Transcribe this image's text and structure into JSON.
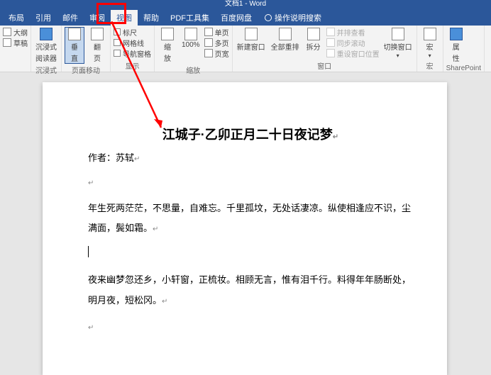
{
  "titlebar": {
    "title": "文档1 - Word"
  },
  "menu": {
    "layout": "布局",
    "references": "引用",
    "mail": "邮件",
    "review": "审阅",
    "view": "视图",
    "help": "帮助",
    "pdf": "PDF工具集",
    "baidu": "百度网盘",
    "search": "操作说明搜索"
  },
  "ribbon": {
    "views": {
      "outline": "大纲",
      "draft": "草稿",
      "immersive_reader_l1": "沉浸式",
      "immersive_reader_l2": "阅读器",
      "immersive_label": "沉浸式",
      "vertical_l1": "垂",
      "vertical_l2": "直",
      "flip_l1": "翻",
      "flip_l2": "页",
      "page_move_label": "页面移动"
    },
    "show": {
      "ruler": "标尺",
      "gridlines": "网格线",
      "navpane": "导航窗格",
      "label": "显示"
    },
    "zoom": {
      "zoom_l1": "缩",
      "zoom_l2": "放",
      "hundred": "100%",
      "single": "单页",
      "multi": "多页",
      "width": "页宽",
      "label": "缩放"
    },
    "window": {
      "new": "新建窗口",
      "all": "全部重排",
      "split": "拆分",
      "side": "并排查看",
      "sync": "同步滚动",
      "reset": "重设窗口位置",
      "switch": "切换窗口",
      "label": "窗口"
    },
    "macro": {
      "macro": "宏",
      "label": "宏"
    },
    "sharepoint": {
      "prop_l1": "属",
      "prop_l2": "性",
      "label": "SharePoint"
    }
  },
  "doc": {
    "title": "江城子·乙卯正月二十日夜记梦",
    "author_label": "作者：",
    "author_name": "苏轼",
    "p1": "年生死两茫茫，不思量，自难忘。千里孤坟，无处话凄凉。纵使相逢应不识，尘满面，鬓如霜。",
    "p2": "夜来幽梦忽还乡，小轩窗，正梳妆。相顾无言，惟有泪千行。料得年年肠断处，明月夜，短松冈。"
  }
}
